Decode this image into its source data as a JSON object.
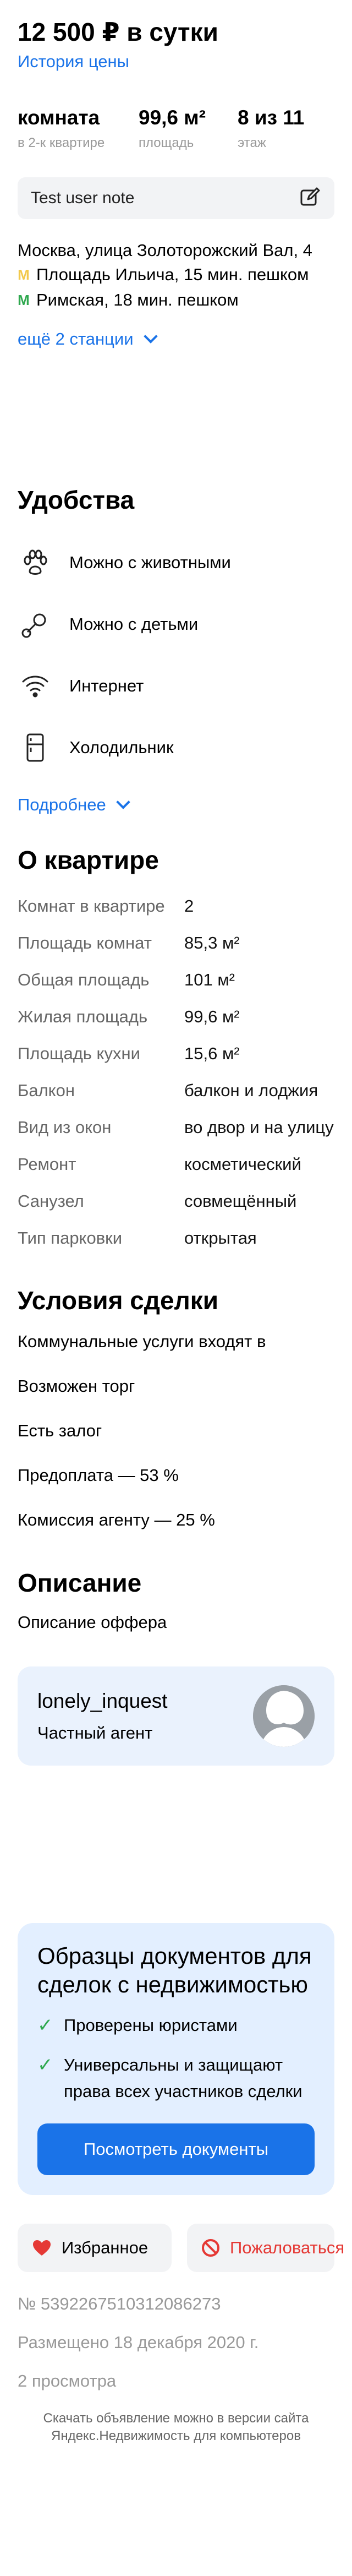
{
  "header": {
    "price_title": "12 500 ₽ в сутки",
    "price_history": "История цены"
  },
  "stats": [
    {
      "value": "комната",
      "label": "в 2-к квартире"
    },
    {
      "value": "99,6 м²",
      "label": "площадь"
    },
    {
      "value": "8 из 11",
      "label": "этаж"
    }
  ],
  "note": {
    "text": "Test user note",
    "icon": "edit-icon"
  },
  "location": {
    "address": "Москва, улица Золоторожский Вал, 4",
    "metro": [
      {
        "line_color": "#f2c94c",
        "text": "Площадь Ильича, 15 мин. пешком"
      },
      {
        "line_color": "#2fa84f",
        "text": "Римская, 18 мин. пешком"
      }
    ],
    "more_stations": "ещё 2 станции"
  },
  "amenities": {
    "title": "Удобства",
    "items": [
      {
        "icon": "paw-icon",
        "label": "Можно с животными"
      },
      {
        "icon": "pacifier-icon",
        "label": "Можно с детьми"
      },
      {
        "icon": "wifi-icon",
        "label": "Интернет"
      },
      {
        "icon": "fridge-icon",
        "label": "Холодильник"
      }
    ],
    "more": "Подробнее"
  },
  "apartment": {
    "title": "О квартире",
    "rows": [
      {
        "key": "Комнат в квартире",
        "value": "2"
      },
      {
        "key": "Площадь комнат",
        "value": "85,3 м²"
      },
      {
        "key": "Общая площадь",
        "value": "101 м²"
      },
      {
        "key": "Жилая площадь",
        "value": "99,6 м²"
      },
      {
        "key": "Площадь кухни",
        "value": "15,6 м²"
      },
      {
        "key": "Балкон",
        "value": "балкон и лоджия"
      },
      {
        "key": "Вид из окон",
        "value": "во двор и на улицу"
      },
      {
        "key": "Ремонт",
        "value": "косметический"
      },
      {
        "key": "Санузел",
        "value": "совмещённый"
      },
      {
        "key": "Тип парковки",
        "value": "открытая"
      }
    ]
  },
  "deal": {
    "title": "Условия сделки",
    "items": [
      "Коммунальные услуги входят в",
      "Возможен торг",
      "Есть залог",
      "Предоплата — 53 %",
      "Комиссия агенту — 25 %"
    ]
  },
  "description": {
    "title": "Описание",
    "text": "Описание оффера"
  },
  "agent": {
    "name": "lonely_inquest",
    "role": "Частный агент"
  },
  "docs": {
    "title": "Образцы документов для сделок с недвижимостью",
    "items": [
      "Проверены юристами",
      "Универсальны и защищают права всех участников сделки"
    ],
    "button": "Посмотреть документы"
  },
  "actions": {
    "favorite": "Избранное",
    "complain": "Пожаловаться"
  },
  "meta": {
    "id": "№ 5392267510312086273",
    "published": "Размещено 18 декабря 2020 г.",
    "views": "2 просмотра"
  },
  "footer": {
    "text": "Скачать объявление можно в версии сайта Яндекс.Недвижимость для компьютеров"
  },
  "colors": {
    "accent": "#1a73e8",
    "check": "#2fa84f",
    "complain": "#e53935",
    "heart": "#e53935"
  }
}
